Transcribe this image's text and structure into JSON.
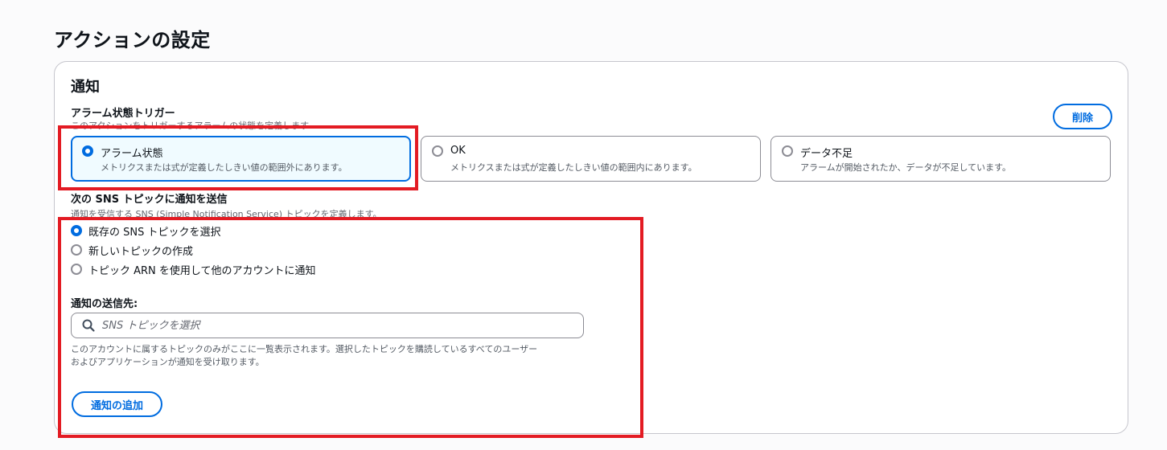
{
  "page": {
    "title": "アクションの設定"
  },
  "notification": {
    "title": "通知",
    "delete_label": "削除",
    "trigger": {
      "label": "アラーム状態トリガー",
      "description": "このアクションをトリガーするアラームの状態を定義します",
      "options": [
        {
          "title": "アラーム状態",
          "description": "メトリクスまたは式が定義したしきい値の範囲外にあります。",
          "selected": true
        },
        {
          "title": "OK",
          "description": "メトリクスまたは式が定義したしきい値の範囲内にあります。",
          "selected": false
        },
        {
          "title": "データ不足",
          "description": "アラームが開始されたか、データが不足しています。",
          "selected": false
        }
      ]
    },
    "sns": {
      "label": "次の SNS トピックに通知を送信",
      "description": "通知を受信する SNS (Simple Notification Service) トピックを定義します。",
      "options": [
        {
          "label": "既存の SNS トピックを選択",
          "selected": true
        },
        {
          "label": "新しいトピックの作成",
          "selected": false
        },
        {
          "label": "トピック ARN を使用して他のアカウントに通知",
          "selected": false
        }
      ]
    },
    "destination": {
      "label": "通知の送信先:",
      "placeholder": "SNS トピックを選択",
      "help_line1": "このアカウントに属するトピックのみがここに一覧表示されます。選択したトピックを購読しているすべてのユーザー",
      "help_line2": "およびアプリケーションが通知を受け取ります。"
    },
    "add_label": "通知の追加"
  },
  "colors": {
    "accent": "#006ce0",
    "highlight": "#e31b23"
  },
  "icons": {
    "search": "search-icon"
  }
}
